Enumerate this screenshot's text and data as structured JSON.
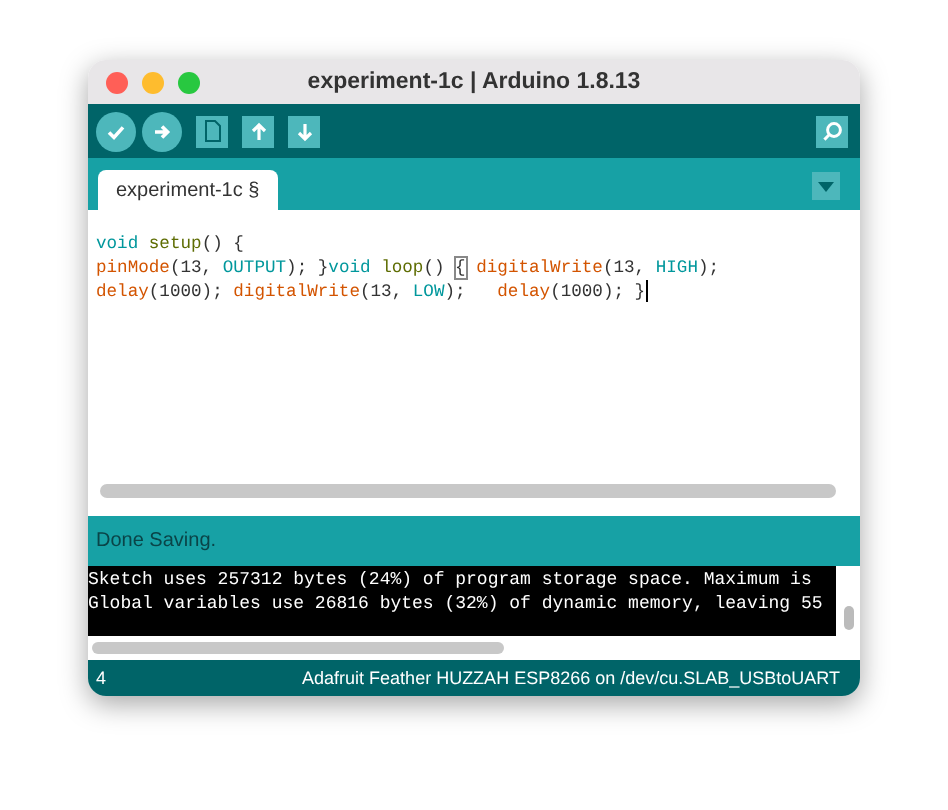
{
  "window": {
    "title": "experiment-1c | Arduino 1.8.13"
  },
  "toolbar": {
    "buttons": [
      {
        "kind": "verify"
      },
      {
        "kind": "upload"
      },
      {
        "kind": "new"
      },
      {
        "kind": "open"
      },
      {
        "kind": "save"
      }
    ]
  },
  "tabs": [
    {
      "label": "experiment-1c §",
      "selected": true
    }
  ],
  "editor": {
    "lines": [
      [
        {
          "text": "void",
          "kind": "keyword"
        },
        {
          "text": " setup",
          "kind": "function"
        },
        {
          "text": "() {",
          "kind": "plain"
        }
      ],
      [
        {
          "text": "pinMode",
          "kind": "builtin"
        },
        {
          "text": "(13, ",
          "kind": "plain"
        },
        {
          "text": "OUTPUT",
          "kind": "constant"
        },
        {
          "text": "); }",
          "kind": "plain"
        },
        {
          "text": "void",
          "kind": "keyword"
        },
        {
          "text": " loop",
          "kind": "function"
        },
        {
          "text": "() ",
          "kind": "plain"
        },
        {
          "text": "{",
          "kind": "bracket"
        },
        {
          "text": " digitalWrite",
          "kind": "builtin"
        },
        {
          "text": "(13, ",
          "kind": "plain"
        },
        {
          "text": "HIGH",
          "kind": "constant"
        },
        {
          "text": ");",
          "kind": "plain"
        }
      ],
      [
        {
          "text": "delay",
          "kind": "builtin"
        },
        {
          "text": "(1000); ",
          "kind": "plain"
        },
        {
          "text": "digitalWrite",
          "kind": "builtin"
        },
        {
          "text": "(13, ",
          "kind": "plain"
        },
        {
          "text": "LOW",
          "kind": "constant"
        },
        {
          "text": ");   ",
          "kind": "plain"
        },
        {
          "text": "delay",
          "kind": "builtin"
        },
        {
          "text": "(1000); }",
          "kind": "plain"
        }
      ]
    ]
  },
  "status": {
    "message": "Done Saving."
  },
  "console": {
    "lines": [
      "Sketch uses 257312 bytes (24%) of program storage space. Maximum is",
      "Global variables use 26816 bytes (32%) of dynamic memory, leaving 55"
    ]
  },
  "footer": {
    "line_number": "4",
    "board": "Adafruit Feather HUZZAH ESP8266 on /dev/cu.SLAB_USBtoUART"
  }
}
